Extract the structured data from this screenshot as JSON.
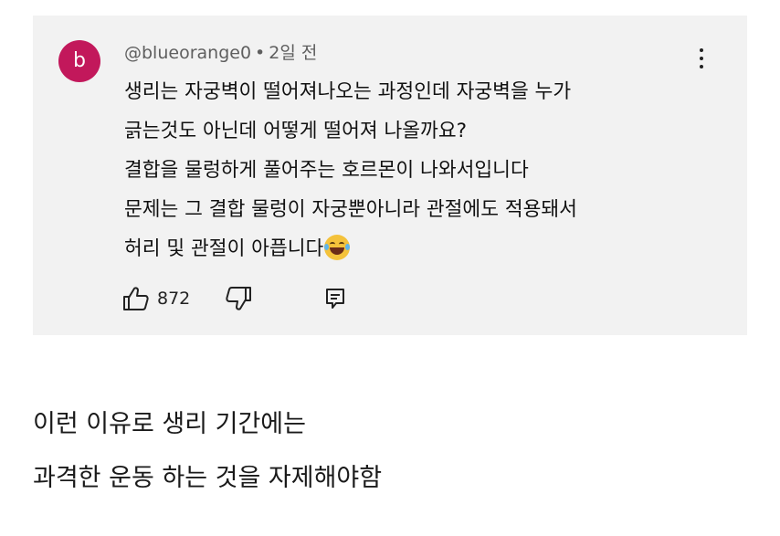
{
  "comment": {
    "avatar_letter": "b",
    "avatar_color": "#c2185b",
    "username": "@blueorange0",
    "separator": "•",
    "time": "2일 전",
    "lines": [
      "생리는 자궁벽이 떨어져나오는 과정인데 자궁벽을 누가",
      "긁는것도 아닌데 어떻게 떨어져 나올까요?",
      "결합을 물렁하게 풀어주는 호르몬이 나와서입니다",
      "문제는 그 결합 물렁이 자궁뿐아니라 관절에도 적용돼서",
      "허리 및 관절이 아픕니다"
    ],
    "emoji": "grinning-squinting-tears-of-joy",
    "like_count": "872",
    "icons": {
      "like": "thumbs-up-icon",
      "dislike": "thumbs-down-icon",
      "reply": "reply-icon",
      "menu": "more-vert-icon"
    }
  },
  "caption": {
    "line1": "이런 이유로 생리 기간에는",
    "line2": "과격한 운동 하는 것을 자제해야함"
  }
}
